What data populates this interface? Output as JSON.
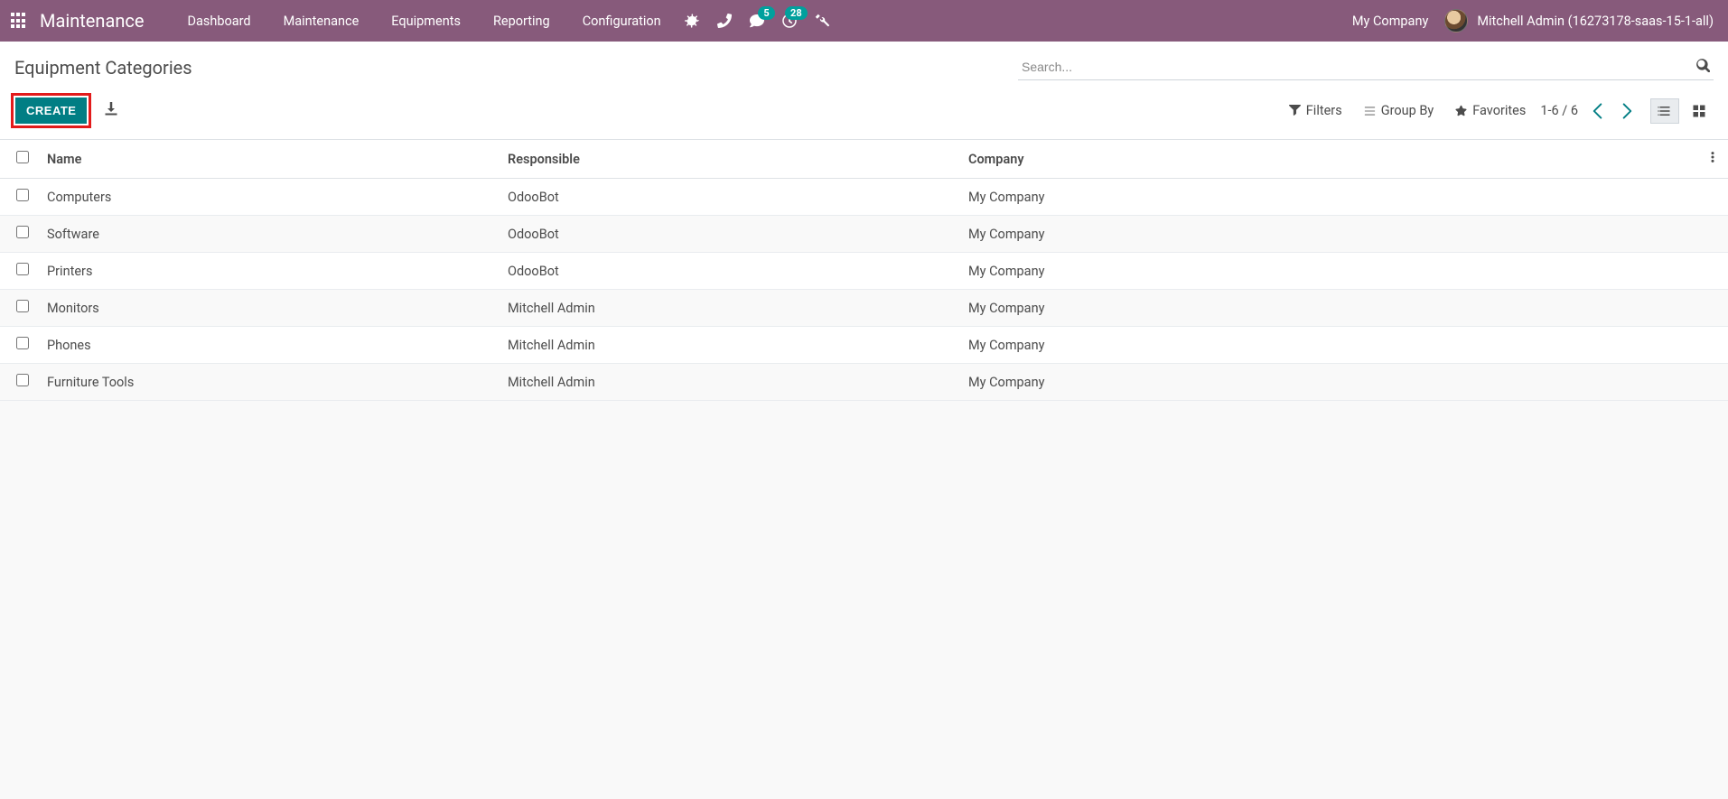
{
  "nav": {
    "brand": "Maintenance",
    "items": [
      "Dashboard",
      "Maintenance",
      "Equipments",
      "Reporting",
      "Configuration"
    ],
    "messaging_badge": "5",
    "activities_badge": "28",
    "company": "My Company",
    "user": "Mitchell Admin (16273178-saas-15-1-all)"
  },
  "control": {
    "title": "Equipment Categories",
    "search_placeholder": "Search...",
    "create_label": "CREATE",
    "filters_label": "Filters",
    "groupby_label": "Group By",
    "favorites_label": "Favorites",
    "pager": "1-6 / 6"
  },
  "table": {
    "headers": {
      "name": "Name",
      "responsible": "Responsible",
      "company": "Company"
    },
    "rows": [
      {
        "name": "Computers",
        "responsible": "OdooBot",
        "company": "My Company"
      },
      {
        "name": "Software",
        "responsible": "OdooBot",
        "company": "My Company"
      },
      {
        "name": "Printers",
        "responsible": "OdooBot",
        "company": "My Company"
      },
      {
        "name": "Monitors",
        "responsible": "Mitchell Admin",
        "company": "My Company"
      },
      {
        "name": "Phones",
        "responsible": "Mitchell Admin",
        "company": "My Company"
      },
      {
        "name": "Furniture Tools",
        "responsible": "Mitchell Admin",
        "company": "My Company"
      }
    ]
  }
}
